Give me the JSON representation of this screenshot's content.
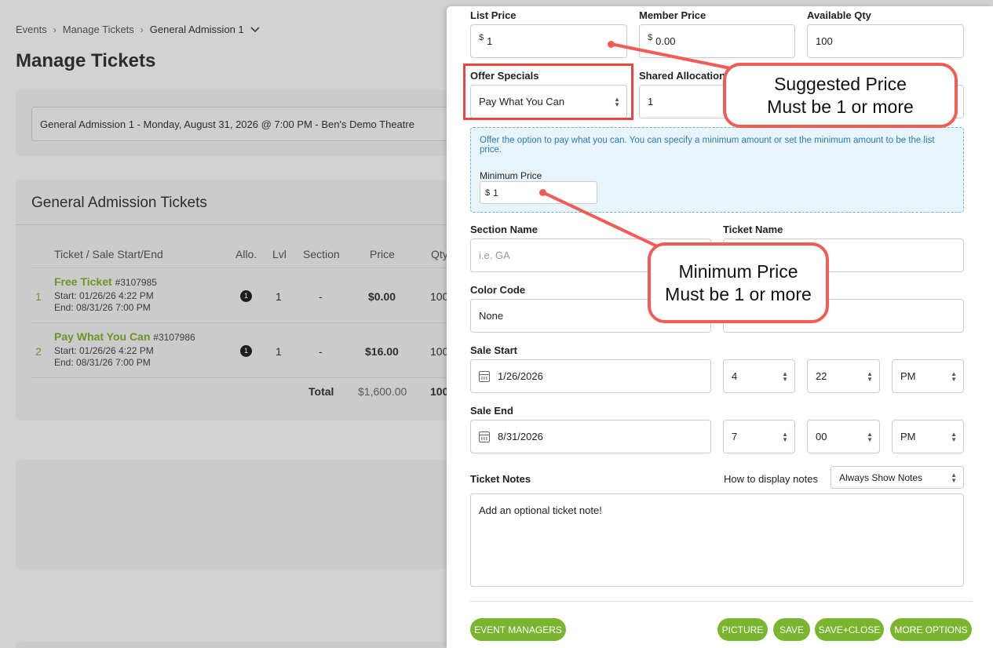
{
  "breadcrumb": {
    "items": [
      "Events",
      "Manage Tickets",
      "General Admission 1"
    ]
  },
  "page": {
    "title": "Manage Tickets"
  },
  "event_select": {
    "value": "General Admission 1 - Monday, August 31, 2026 @ 7:00 PM - Ben's Demo Theatre"
  },
  "tickets": {
    "heading": "General Admission Tickets",
    "columns": [
      "Ticket / Sale Start/End",
      "Allo.",
      "Lvl",
      "Section",
      "Price",
      "Qty"
    ],
    "rows": [
      {
        "num": "1",
        "name": "Free Ticket",
        "id": "#3107985",
        "start": "Start: 01/26/26 4:22 PM",
        "end": "End: 08/31/26 7:00 PM",
        "allo": "1",
        "lvl": "1",
        "section": "-",
        "price": "$0.00",
        "qty": "100"
      },
      {
        "num": "2",
        "name": "Pay What You Can",
        "id": "#3107986",
        "start": "Start: 01/26/26 4:22 PM",
        "end": "End: 08/31/26 7:00 PM",
        "allo": "1",
        "lvl": "1",
        "section": "-",
        "price": "$16.00",
        "qty": "100"
      }
    ],
    "total_label": "Total",
    "total_price": "$1,600.00",
    "total_qty": "100"
  },
  "form": {
    "list_price": {
      "label": "List Price",
      "currency": "$",
      "value": "1"
    },
    "member_price": {
      "label": "Member Price",
      "currency": "$",
      "value": "0.00"
    },
    "available_qty": {
      "label": "Available Qty",
      "value": "100"
    },
    "offer_specials": {
      "label": "Offer Specials",
      "value": "Pay What You Can"
    },
    "shared_allocation": {
      "label": "Shared Allocation",
      "value": "1"
    },
    "pwyc_info": "Offer the option to pay what you can. You can specify a minimum amount or set the minimum amount to be the list price.",
    "minimum_price": {
      "label": "Minimum Price",
      "currency": "$",
      "value": "1"
    },
    "section_name": {
      "label": "Section Name",
      "placeholder": "i.e. GA"
    },
    "ticket_name": {
      "label": "Ticket Name"
    },
    "color_code": {
      "label": "Color Code",
      "value": "None"
    },
    "sale_start": {
      "label": "Sale Start",
      "date": "1/26/2026",
      "hour": "4",
      "minute": "22",
      "ampm": "PM"
    },
    "sale_end": {
      "label": "Sale End",
      "date": "8/31/2026",
      "hour": "7",
      "minute": "00",
      "ampm": "PM"
    },
    "ticket_notes": {
      "label": "Ticket Notes",
      "display_label": "How to display notes",
      "display_value": "Always Show Notes",
      "placeholder": "Add an optional ticket note!"
    }
  },
  "buttons": {
    "event_managers": "EVENT MANAGERS",
    "picture": "PICTURE",
    "save": "SAVE",
    "save_close": "SAVE+CLOSE",
    "more_options": "MORE OPTIONS"
  },
  "annotations": {
    "suggested_line1": "Suggested Price",
    "suggested_line2": "Must be 1 or more",
    "minimum_line1": "Minimum Price",
    "minimum_line2": "Must be 1 or more"
  },
  "colors": {
    "accent_green": "#7ab52f",
    "annotation_red": "#f25c54",
    "info_blue": "#2a7db5"
  }
}
